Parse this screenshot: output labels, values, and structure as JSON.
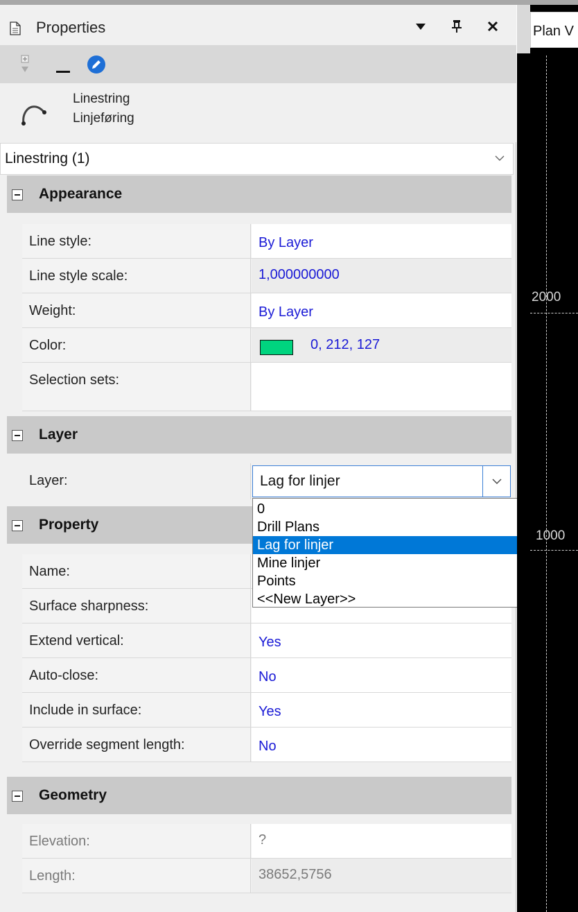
{
  "panel": {
    "title": "Properties",
    "buttons": {
      "dropdown": "▾",
      "pin": "⫟",
      "close": "✕"
    }
  },
  "toolbar": {
    "icons": [
      "filter-icon",
      "minimize-icon",
      "edit-icon"
    ]
  },
  "info": {
    "type_en": "Linestring",
    "type_no": "Linjeføring"
  },
  "selector": {
    "value": "Linestring (1)"
  },
  "sections": {
    "appearance": "Appearance",
    "layer": "Layer",
    "property": "Property",
    "geometry": "Geometry"
  },
  "appearance": {
    "line_style": {
      "label": "Line style:",
      "value": "By Layer"
    },
    "line_style_scale": {
      "label": "Line style scale:",
      "value": "1,000000000"
    },
    "weight": {
      "label": "Weight:",
      "value": "By Layer"
    },
    "color": {
      "label": "Color:",
      "value": "0, 212, 127",
      "hex": "#00d47f"
    },
    "selection_sets": {
      "label": "Selection sets:",
      "value": ""
    }
  },
  "layer": {
    "label": "Layer:",
    "value": "Lag for linjer",
    "options": [
      "0",
      "Drill Plans",
      "Lag for linjer",
      "Mine linjer",
      "Points",
      "<<New Layer>>"
    ],
    "selected_index": 2
  },
  "property": {
    "name": {
      "label": "Name:",
      "value": ""
    },
    "surface_sharpness": {
      "label": "Surface sharpness:",
      "value": ""
    },
    "extend_vertical": {
      "label": "Extend vertical:",
      "value": "Yes"
    },
    "auto_close": {
      "label": "Auto-close:",
      "value": "No"
    },
    "include_in_surface": {
      "label": "Include in surface:",
      "value": "Yes"
    },
    "override_segment_length": {
      "label": "Override segment length:",
      "value": "No"
    }
  },
  "geometry": {
    "elevation": {
      "label": "Elevation:",
      "value": "?"
    },
    "length": {
      "label": "Length:",
      "value": "38652,5756"
    }
  },
  "plan_view": {
    "tab_label": "Plan V",
    "axis_labels": [
      "2000",
      "1000"
    ]
  },
  "colors": {
    "accent": "#0078d7",
    "value_text": "#1a1ad6",
    "section_bg": "#c9c9c9"
  }
}
